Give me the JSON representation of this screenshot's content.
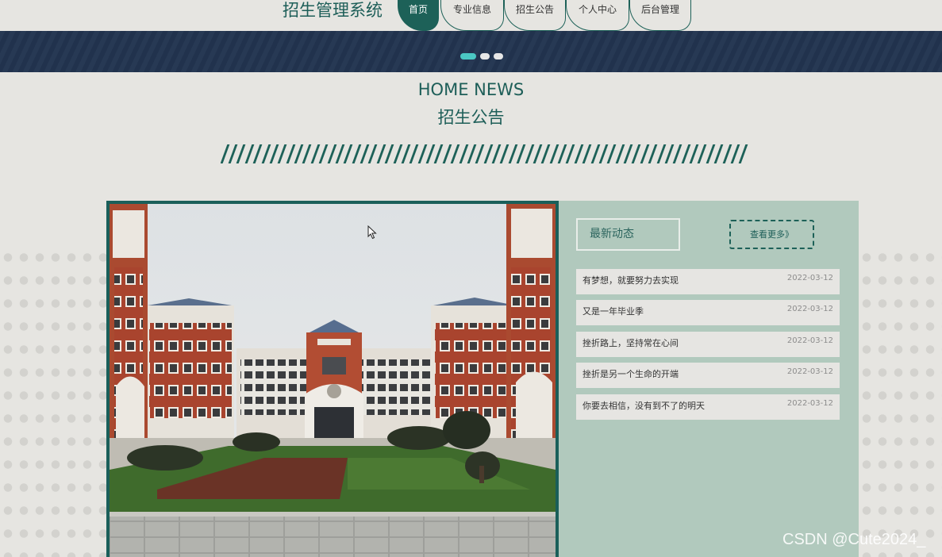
{
  "site_title": "招生管理系统",
  "nav": [
    {
      "label": "首页",
      "active": true
    },
    {
      "label": "专业信息",
      "active": false
    },
    {
      "label": "招生公告",
      "active": false
    },
    {
      "label": "个人中心",
      "active": false
    },
    {
      "label": "后台管理",
      "active": false
    }
  ],
  "carousel": {
    "slide_count": 3,
    "active_index": 0
  },
  "section": {
    "title_en": "HOME NEWS",
    "title_cn": "招生公告"
  },
  "news": {
    "title": "最新动态",
    "more_label": "查看更多》",
    "items": [
      {
        "title": "有梦想，就要努力去实现",
        "date": "2022-03-12"
      },
      {
        "title": "又是一年毕业季",
        "date": "2022-03-12"
      },
      {
        "title": "挫折路上，坚持常在心间",
        "date": "2022-03-12"
      },
      {
        "title": "挫折是另一个生命的开端",
        "date": "2022-03-12"
      },
      {
        "title": "你要去相信，没有到不了的明天",
        "date": "2022-03-12"
      }
    ]
  },
  "watermark": "CSDN @Cute2024_",
  "colors": {
    "primary": "#1d6158",
    "banner": "#233551",
    "panel": "#b1c9bd",
    "background": "#e6e5e1",
    "dot_active": "#4bc8c4"
  }
}
